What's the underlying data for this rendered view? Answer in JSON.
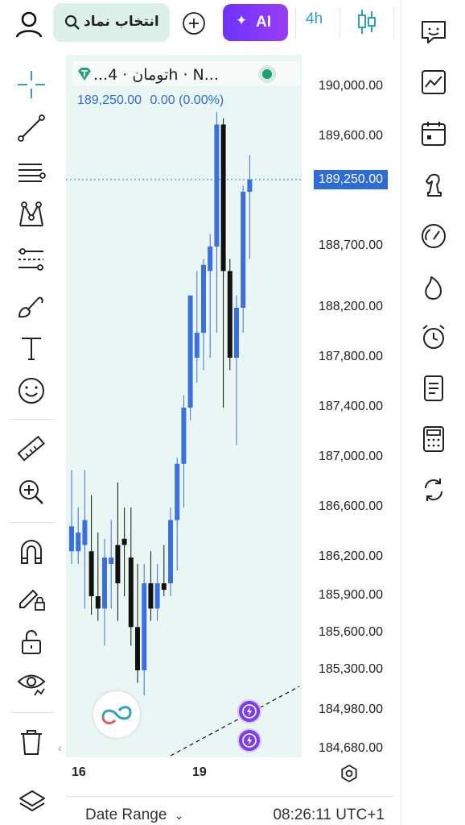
{
  "top_bar": {
    "search_label": "انتخاب نماد",
    "ai_label": "AI",
    "interval": "4h"
  },
  "legend": {
    "symbol": "...تومان · 4h · N...",
    "price": "189,250.00",
    "change": "0.00 (0.00%)",
    "status_color": "#1a9e74"
  },
  "price_axis": {
    "labels": [
      "190,000.00",
      "189,600.00",
      "188,700.00",
      "188,200.00",
      "187,800.00",
      "187,400.00",
      "187,000.00",
      "186,600.00",
      "186,200.00",
      "185,900.00",
      "185,600.00",
      "185,300.00",
      "184,980.00",
      "184,680.00"
    ],
    "last_price": "189,250.00"
  },
  "time_axis": {
    "labels": [
      "16",
      "19"
    ]
  },
  "bottom_bar": {
    "date_range": "Date Range",
    "clock": "08:26:11 UTC+1"
  },
  "colors": {
    "up": "#3a6fdc",
    "down": "#111111",
    "accent": "#2aa3b8",
    "ai": "#7b3fe4",
    "chart_bg": "#e9f6f3"
  },
  "chart_data": {
    "type": "candlestick",
    "interval": "4h",
    "y_unit": "Toman",
    "ylim": [
      184680,
      190000
    ],
    "candles": [
      {
        "o": 186450,
        "h": 186900,
        "l": 186150,
        "c": 186250,
        "dir": "up"
      },
      {
        "o": 186250,
        "h": 186600,
        "l": 186150,
        "c": 186400,
        "dir": "up"
      },
      {
        "o": 186300,
        "h": 186900,
        "l": 185800,
        "c": 186500,
        "dir": "up"
      },
      {
        "o": 186250,
        "h": 186700,
        "l": 185750,
        "c": 185900,
        "dir": "down"
      },
      {
        "o": 185900,
        "h": 186400,
        "l": 185700,
        "c": 185800,
        "dir": "down"
      },
      {
        "o": 185800,
        "h": 186350,
        "l": 185500,
        "c": 186200,
        "dir": "up"
      },
      {
        "o": 186150,
        "h": 186500,
        "l": 185800,
        "c": 186200,
        "dir": "up"
      },
      {
        "o": 186300,
        "h": 186800,
        "l": 185700,
        "c": 186000,
        "dir": "down"
      },
      {
        "o": 186350,
        "h": 186600,
        "l": 185900,
        "c": 186300,
        "dir": "down"
      },
      {
        "o": 186200,
        "h": 186600,
        "l": 185500,
        "c": 185650,
        "dir": "down"
      },
      {
        "o": 185650,
        "h": 186150,
        "l": 185200,
        "c": 185300,
        "dir": "down"
      },
      {
        "o": 185300,
        "h": 186150,
        "l": 185100,
        "c": 186000,
        "dir": "up"
      },
      {
        "o": 186000,
        "h": 186250,
        "l": 185700,
        "c": 185800,
        "dir": "down"
      },
      {
        "o": 185800,
        "h": 186150,
        "l": 185700,
        "c": 186000,
        "dir": "up"
      },
      {
        "o": 185950,
        "h": 186300,
        "l": 185900,
        "c": 186000,
        "dir": "down"
      },
      {
        "o": 186000,
        "h": 186600,
        "l": 185900,
        "c": 186500,
        "dir": "up"
      },
      {
        "o": 186500,
        "h": 187000,
        "l": 186100,
        "c": 186950,
        "dir": "up"
      },
      {
        "o": 186950,
        "h": 187500,
        "l": 186600,
        "c": 187400,
        "dir": "up"
      },
      {
        "o": 187400,
        "h": 188300,
        "l": 187300,
        "c": 188300,
        "dir": "up"
      },
      {
        "o": 187800,
        "h": 188500,
        "l": 187600,
        "c": 188000,
        "dir": "up"
      },
      {
        "o": 188000,
        "h": 188600,
        "l": 187700,
        "c": 188550,
        "dir": "up"
      },
      {
        "o": 188500,
        "h": 188800,
        "l": 187800,
        "c": 188700,
        "dir": "up"
      },
      {
        "o": 188700,
        "h": 189800,
        "l": 188000,
        "c": 189700,
        "dir": "up"
      },
      {
        "o": 189700,
        "h": 189750,
        "l": 187400,
        "c": 188500,
        "dir": "down"
      },
      {
        "o": 188500,
        "h": 188600,
        "l": 187700,
        "c": 187800,
        "dir": "down"
      },
      {
        "o": 187800,
        "h": 188300,
        "l": 187100,
        "c": 188200,
        "dir": "up"
      },
      {
        "o": 188200,
        "h": 189200,
        "l": 188000,
        "c": 189150,
        "dir": "up"
      },
      {
        "o": 189150,
        "h": 189450,
        "l": 188600,
        "c": 189250,
        "dir": "up"
      }
    ]
  }
}
